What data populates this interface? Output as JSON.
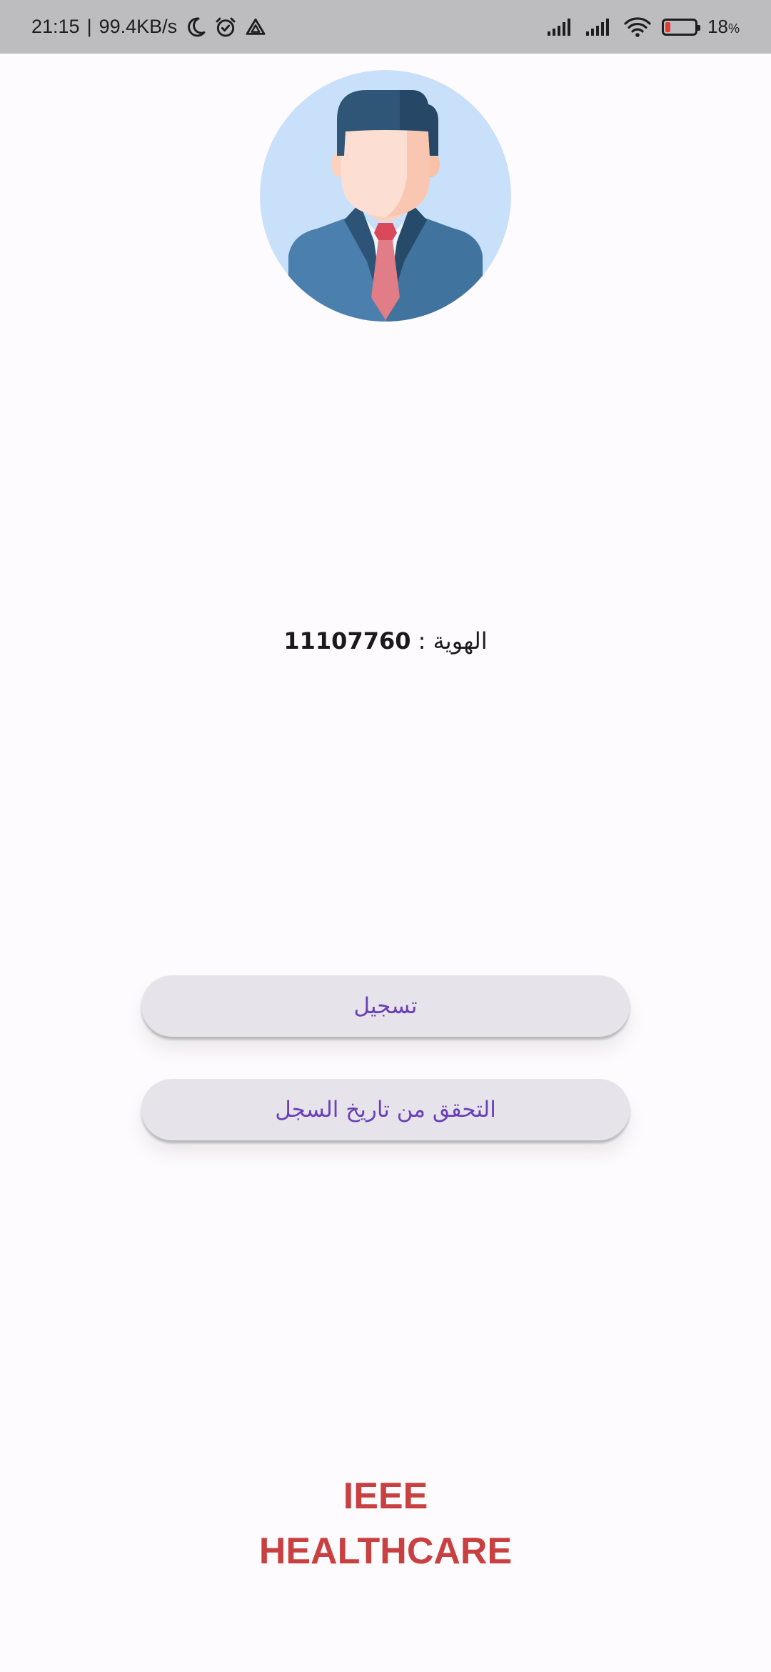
{
  "status_bar": {
    "time": "21:15",
    "separator": "|",
    "network_speed": "99.4KB/s",
    "left_icons": [
      "moon-icon",
      "alarm-icon",
      "drive-icon"
    ],
    "right_icons": [
      "signal-icon",
      "signal-icon",
      "wifi-icon",
      "battery-icon"
    ],
    "battery_percent": "18",
    "battery_percent_sign": "%",
    "battery_level": 0.18,
    "battery_color": "#E53935"
  },
  "profile": {
    "avatar_icon": "businessman-avatar-icon",
    "id_label": "الهوية :",
    "id_value": "11107760"
  },
  "actions": {
    "register_label": "تسجيل",
    "history_label": "التحقق من تاريخ السجل"
  },
  "brand": {
    "line1": "IEEE",
    "line2": "HEALTHCARE",
    "color": "#C94040"
  },
  "colors": {
    "background": "#FEFBFE",
    "status_bar": "#BDBCBE",
    "button_bg": "#E6E4EA",
    "button_text": "#6A40B8"
  }
}
